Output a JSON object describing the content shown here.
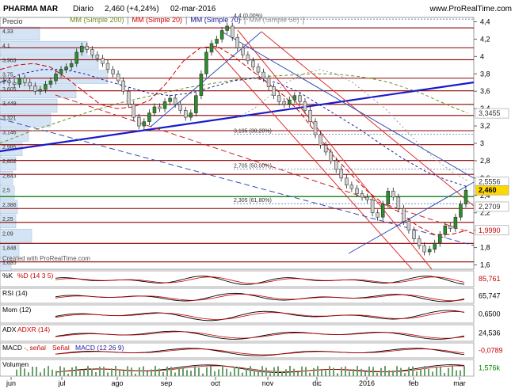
{
  "header": {
    "instrument": "PHARMA MAR",
    "period": "Diario",
    "quote": "2,460 (+4,24%)",
    "date": "02-mar-2016",
    "site": "www.ProRealTime.com"
  },
  "price_panel": {
    "corner_label": "Precio",
    "watermark": "Created with ProRealTime.com",
    "legend": [
      {
        "label": "MM (Simple 200)",
        "color": "#6b8e23"
      },
      {
        "label": "MM (Simple 20)",
        "color": "#cc0000"
      },
      {
        "label": "MM (Simple 70)",
        "color": "#1a1a9e"
      },
      {
        "label": "MM (Simple 50)",
        "color": "#999999"
      }
    ],
    "right_ticks": [
      "4,4",
      "4,2",
      "4",
      "3,8",
      "3,6",
      "3,4",
      "3,2",
      "3",
      "2,8",
      "2,6",
      "2,4",
      "2,2",
      "2",
      "1,8",
      "1,6"
    ],
    "right_badges": [
      {
        "text": "3,3455",
        "value": 3.3455,
        "fg": "#333333",
        "bg": "#ffffff"
      },
      {
        "text": "2,5556",
        "value": 2.5556,
        "fg": "#333333",
        "bg": "#ffffff"
      },
      {
        "text": "2,460",
        "value": 2.46,
        "fg": "#000000",
        "bg": "#ffd700"
      },
      {
        "text": "2,2709",
        "value": 2.2709,
        "fg": "#333333",
        "bg": "#ffffff"
      },
      {
        "text": "1,9990",
        "value": 1.999,
        "fg": "#cc0000",
        "bg": "#ffffff"
      }
    ],
    "left_labels": [
      "4,33",
      "4,1",
      "3,963",
      "3,75",
      "3,605",
      "3,449",
      "3,321",
      "3,146",
      "2,985",
      "2,802",
      "2,643",
      "2,5",
      "2,386",
      "2,25",
      "2,09",
      "1,848",
      "1,635"
    ],
    "volume_profile_widths": [
      0.25,
      0.55,
      0.62,
      0.68,
      0.48,
      0.36,
      0.32,
      0.18,
      0.14,
      0.1,
      0.08,
      0.09,
      0.11,
      0.1,
      0.2,
      0.12,
      0.07
    ],
    "fib_labels": [
      {
        "text": "4,4 (0,00%)",
        "value": 4.43
      },
      {
        "text": "3,105 (38,20%)",
        "value": 3.105
      },
      {
        "text": "2,705 (50,00%)",
        "value": 2.705
      },
      {
        "text": "2,305 (61,80%)",
        "value": 2.305
      }
    ],
    "hlines_dark_red": [
      4.33,
      4.1,
      3.963,
      3.75,
      3.605,
      3.449,
      3.321,
      3.146,
      2.985,
      2.802,
      2.643,
      2.386,
      2.25,
      2.09,
      1.848,
      1.635
    ],
    "hline_green": 2.386
  },
  "indicators": [
    {
      "label": "%K",
      "sub": "%D (14 3 5)",
      "badge": "85,761",
      "badge_color": "#cc0000"
    },
    {
      "label": "RSI (14)",
      "sub": "",
      "badge": "65,747",
      "badge_color": "#000000"
    },
    {
      "label": "Mom (12)",
      "sub": "",
      "badge": "0,6500",
      "badge_color": "#000000"
    },
    {
      "label": "ADX",
      "sub": "ADXR (14)",
      "badge": "24,536",
      "badge_color": "#000000"
    },
    {
      "label": "MACD",
      "sub": "MACD (12 26 9)",
      "badge": "-0,0789",
      "badge_color": "#cc0000"
    },
    {
      "label": "Volumen",
      "sub": "",
      "badge": "1,576k",
      "badge_color": "#008800"
    }
  ],
  "macd_extra": [
    "-, señal",
    "Señal"
  ],
  "chart_data": {
    "type": "line",
    "x_months": [
      "jun",
      "jul",
      "ago",
      "sep",
      "oct",
      "nov",
      "dic",
      "2016",
      "feb",
      "mar"
    ],
    "ylim": [
      1.55,
      4.45
    ],
    "series": [
      {
        "name": "Precio",
        "values": [
          3.72,
          3.7,
          3.68,
          3.75,
          3.7,
          3.66,
          3.6,
          3.62,
          3.68,
          3.72,
          3.8,
          3.85,
          3.88,
          3.92,
          4.05,
          4.12,
          4.08,
          4.02,
          3.98,
          3.92,
          3.85,
          3.8,
          3.72,
          3.6,
          3.45,
          3.3,
          3.2,
          3.25,
          3.35,
          3.42,
          3.4,
          3.48,
          3.52,
          3.45,
          3.38,
          3.3,
          3.35,
          3.55,
          3.8,
          4.05,
          4.15,
          4.2,
          4.3,
          4.35,
          4.22,
          4.1,
          4.02,
          3.95,
          3.88,
          3.82,
          3.75,
          3.65,
          3.55,
          3.48,
          3.45,
          3.5,
          3.55,
          3.48,
          3.38,
          3.25,
          3.1,
          2.98,
          2.9,
          2.8,
          2.7,
          2.6,
          2.52,
          2.48,
          2.42,
          2.38,
          2.35,
          2.2,
          2.15,
          2.3,
          2.45,
          2.38,
          2.25,
          2.1,
          2.0,
          1.9,
          1.82,
          1.75,
          1.78,
          1.85,
          1.95,
          2.05,
          2.02,
          2.15,
          2.3,
          2.46
        ]
      },
      {
        "name": "MM (Simple 200)",
        "values": [
          3.0,
          3.07,
          3.14,
          3.2,
          3.26,
          3.32,
          3.38,
          3.43,
          3.48,
          3.52,
          3.56,
          3.6,
          3.64,
          3.67,
          3.7,
          3.73,
          3.75,
          3.77,
          3.78,
          3.79,
          3.8,
          3.8,
          3.79,
          3.77,
          3.74,
          3.7,
          3.64,
          3.58,
          3.5,
          3.42,
          3.35
        ]
      },
      {
        "name": "MM (Simple 20)",
        "values": [
          3.85,
          3.9,
          3.92,
          3.88,
          3.75,
          3.6,
          3.45,
          3.4,
          3.42,
          3.5,
          3.7,
          3.95,
          4.1,
          4.12,
          4.0,
          3.85,
          3.7,
          3.55,
          3.35,
          3.1,
          2.85,
          2.65,
          2.45,
          2.3,
          2.2,
          2.05,
          1.95,
          1.95,
          2.0
        ]
      },
      {
        "name": "MM (Simple 70)",
        "values": [
          3.7,
          3.8,
          3.85,
          3.85,
          3.8,
          3.72,
          3.65,
          3.58,
          3.55,
          3.58,
          3.65,
          3.72,
          3.75,
          3.7,
          3.6,
          3.45,
          3.3,
          3.15,
          2.98,
          2.82,
          2.68,
          2.58,
          2.5
        ]
      },
      {
        "name": "MM (Simple 50)",
        "values": [
          3.3,
          3.4,
          3.55,
          3.7,
          3.8,
          3.85,
          3.8,
          3.7,
          3.55,
          3.4,
          3.2,
          3.0,
          2.82,
          2.68,
          2.57
        ]
      }
    ]
  }
}
